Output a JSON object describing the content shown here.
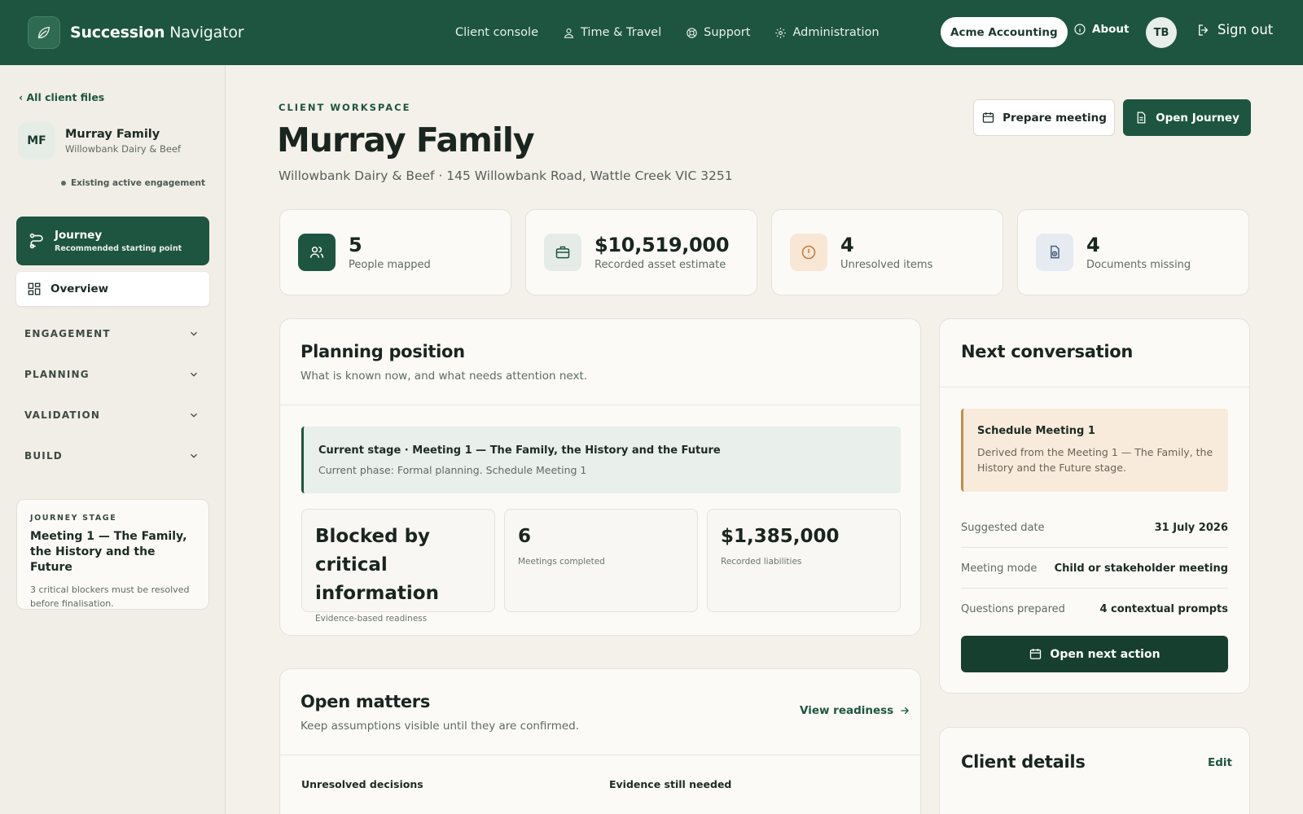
{
  "app": {
    "brand_bold": "Succession",
    "brand_light": "Navigator",
    "nav": [
      "Client console",
      "Time & Travel",
      "Support",
      "Administration"
    ],
    "org": "Acme Accounting",
    "about": "About",
    "user_initials": "TB",
    "sign_out": "Sign out"
  },
  "sidebar": {
    "back": "‹ All client files",
    "client_initials": "MF",
    "client_name": "Murray Family",
    "client_business": "Willowbank Dairy & Beef",
    "engagement_status": "Existing active engagement",
    "journey_label": "Journey",
    "journey_sub": "Recommended starting point",
    "overview_label": "Overview",
    "sections": [
      "ENGAGEMENT",
      "PLANNING",
      "VALIDATION",
      "BUILD"
    ],
    "stage_label": "JOURNEY STAGE",
    "stage_title": "Meeting 1 — The Family, the History and the Future",
    "stage_note": "3 critical blockers must be resolved before finalisation."
  },
  "header": {
    "eyebrow": "CLIENT WORKSPACE",
    "title": "Murray Family",
    "subtitle": "Willowbank Dairy & Beef · 145 Willowbank Road, Wattle Creek VIC 3251",
    "prepare_btn": "Prepare meeting",
    "open_btn": "Open Journey"
  },
  "stats": [
    {
      "value": "5",
      "label": "People mapped"
    },
    {
      "value": "$10,519,000",
      "label": "Recorded asset estimate"
    },
    {
      "value": "4",
      "label": "Unresolved items"
    },
    {
      "value": "4",
      "label": "Documents missing"
    }
  ],
  "planning": {
    "title": "Planning position",
    "subtitle": "What is known now, and what needs attention next.",
    "stage_line": "Current stage · Meeting 1 — The Family, the History and the Future",
    "phase_line": "Current phase: Formal planning. Schedule Meeting 1",
    "metrics": [
      {
        "value": "Blocked by critical information",
        "label": "Evidence-based readiness"
      },
      {
        "value": "6",
        "label": "Meetings completed"
      },
      {
        "value": "$1,385,000",
        "label": "Recorded liabilities"
      }
    ]
  },
  "next": {
    "title": "Next conversation",
    "callout_title": "Schedule Meeting 1",
    "callout_text": "Derived from the Meeting 1 — The Family, the History and the Future stage.",
    "rows": [
      {
        "key": "Suggested date",
        "value": "31 July 2026"
      },
      {
        "key": "Meeting mode",
        "value": "Child or stakeholder meeting"
      },
      {
        "key": "Questions prepared",
        "value": "4 contextual prompts"
      }
    ],
    "action_btn": "Open next action"
  },
  "matters": {
    "title": "Open matters",
    "subtitle": "Keep assumptions visible until they are confirmed.",
    "link": "View readiness",
    "col1": "Unresolved decisions",
    "col2": "Evidence still needed"
  },
  "details": {
    "title": "Client details",
    "edit": "Edit"
  },
  "colors": {
    "primary": "#1d5540",
    "background": "#f4f1ea",
    "warning_bg": "#f8ebdb",
    "warning_accent": "#c58d47"
  }
}
